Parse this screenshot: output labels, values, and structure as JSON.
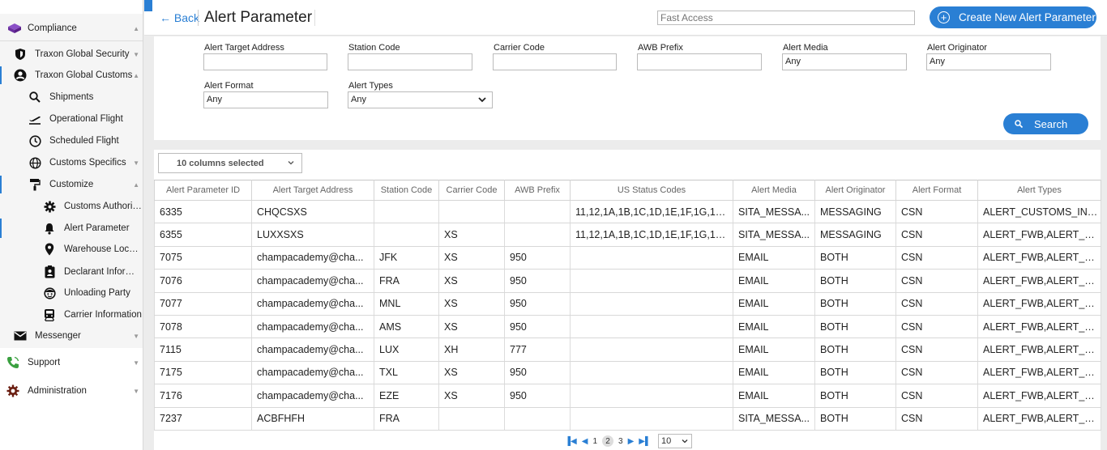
{
  "sidebar": {
    "items": [
      {
        "label": "Compliance",
        "icon": "cube-icon"
      },
      {
        "label": "Traxon Global Security",
        "icon": "shield-icon"
      },
      {
        "label": "Traxon Global Customs",
        "icon": "user-circle-icon"
      },
      {
        "label": "Shipments",
        "icon": "search-icon"
      },
      {
        "label": "Operational Flight",
        "icon": "plane-departure-icon"
      },
      {
        "label": "Scheduled Flight",
        "icon": "clock-icon"
      },
      {
        "label": "Customs Specifics",
        "icon": "globe-icon"
      },
      {
        "label": "Customize",
        "icon": "paint-roller-icon"
      },
      {
        "label": "Customs Authority...",
        "icon": "gear-icon"
      },
      {
        "label": "Alert Parameter",
        "icon": "bell-icon"
      },
      {
        "label": "Warehouse Location",
        "icon": "map-pin-icon"
      },
      {
        "label": "Declarant Informat...",
        "icon": "id-badge-icon"
      },
      {
        "label": "Unloading Party",
        "icon": "face-icon"
      },
      {
        "label": "Carrier Information",
        "icon": "train-icon"
      },
      {
        "label": "Messenger",
        "icon": "envelope-icon"
      },
      {
        "label": "Support",
        "icon": "phone-icon"
      },
      {
        "label": "Administration",
        "icon": "cog-icon"
      }
    ]
  },
  "header": {
    "back_label": "Back",
    "title": "Alert Parameter",
    "fast_access_placeholder": "Fast Access",
    "create_label": "Create New Alert Parameter"
  },
  "filters": {
    "alert_target_address": {
      "label": "Alert Target Address",
      "value": ""
    },
    "station_code": {
      "label": "Station Code",
      "value": ""
    },
    "carrier_code": {
      "label": "Carrier Code",
      "value": ""
    },
    "awb_prefix": {
      "label": "AWB Prefix",
      "value": ""
    },
    "alert_media": {
      "label": "Alert Media",
      "value": "Any"
    },
    "alert_originator": {
      "label": "Alert Originator",
      "value": "Any"
    },
    "alert_format": {
      "label": "Alert Format",
      "value": "Any"
    },
    "alert_types": {
      "label": "Alert Types",
      "value": "Any"
    },
    "search_label": "Search"
  },
  "grid": {
    "columns_selected": "10 columns selected",
    "headers": [
      "Alert Parameter ID",
      "Alert Target Address",
      "Station Code",
      "Carrier Code",
      "AWB Prefix",
      "US Status Codes",
      "Alert Media",
      "Alert Originator",
      "Alert Format",
      "Alert Types"
    ],
    "rows": [
      [
        "6335",
        "CHQCSXS",
        "",
        "",
        "",
        "11,12,1A,1B,1C,1D,1E,1F,1G,1H,1...",
        "SITA_MESSA...",
        "MESSAGING",
        "CSN",
        "ALERT_CUSTOMS_INF..."
      ],
      [
        "6355",
        "LUXXSXS",
        "",
        "XS",
        "",
        "11,12,1A,1B,1C,1D,1E,1F,1G,1H,1...",
        "SITA_MESSA...",
        "MESSAGING",
        "CSN",
        "ALERT_FWB,ALERT_FH..."
      ],
      [
        "7075",
        "champacademy@cha...",
        "JFK",
        "XS",
        "950",
        "",
        "EMAIL",
        "BOTH",
        "CSN",
        "ALERT_FWB,ALERT_FH..."
      ],
      [
        "7076",
        "champacademy@cha...",
        "FRA",
        "XS",
        "950",
        "",
        "EMAIL",
        "BOTH",
        "CSN",
        "ALERT_FWB,ALERT_FH..."
      ],
      [
        "7077",
        "champacademy@cha...",
        "MNL",
        "XS",
        "950",
        "",
        "EMAIL",
        "BOTH",
        "CSN",
        "ALERT_FWB,ALERT_FH..."
      ],
      [
        "7078",
        "champacademy@cha...",
        "AMS",
        "XS",
        "950",
        "",
        "EMAIL",
        "BOTH",
        "CSN",
        "ALERT_FWB,ALERT_FH..."
      ],
      [
        "7115",
        "champacademy@cha...",
        "LUX",
        "XH",
        "777",
        "",
        "EMAIL",
        "BOTH",
        "CSN",
        "ALERT_FWB,ALERT_FH..."
      ],
      [
        "7175",
        "champacademy@cha...",
        "TXL",
        "XS",
        "950",
        "",
        "EMAIL",
        "BOTH",
        "CSN",
        "ALERT_FWB,ALERT_FHL"
      ],
      [
        "7176",
        "champacademy@cha...",
        "EZE",
        "XS",
        "950",
        "",
        "EMAIL",
        "BOTH",
        "CSN",
        "ALERT_FWB,ALERT_FH..."
      ],
      [
        "7237",
        "ACBFHFH",
        "FRA",
        "",
        "",
        "",
        "SITA_MESSA...",
        "BOTH",
        "CSN",
        "ALERT_FWB,ALERT_FH..."
      ]
    ]
  },
  "pager": {
    "pages": [
      "1",
      "2",
      "3"
    ],
    "current_page": "2",
    "page_size": "10"
  },
  "colors": {
    "accent": "#2a7fd4",
    "compliance_icon": "#7a3fb3",
    "support_icon": "#3aa040",
    "admin_icon": "#8a2a1a"
  }
}
